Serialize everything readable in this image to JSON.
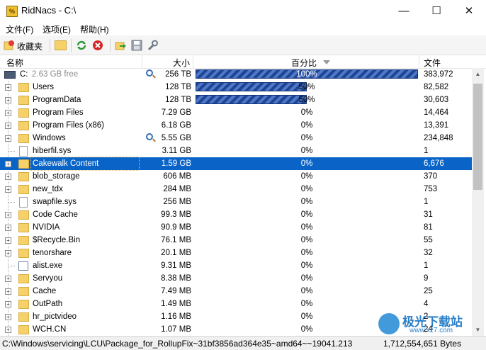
{
  "window": {
    "app_icon": "%",
    "title": "RidNacs - C:\\",
    "controls": {
      "minimize": "—",
      "maximize": "☐",
      "close": "✕"
    }
  },
  "menu": [
    "文件(F)",
    "选项(E)",
    "帮助(H)"
  ],
  "toolbar": {
    "favorites_label": "收藏夹",
    "icons": [
      "favorites-icon",
      "folder-open-icon",
      "refresh-icon",
      "stop-icon",
      "export-icon",
      "save-icon",
      "settings-icon"
    ]
  },
  "columns": {
    "name": "名称",
    "size": "大小",
    "percent": "百分比",
    "files": "文件"
  },
  "drive": {
    "label": "C:",
    "free": "2.63 GB free",
    "size": "256 TB",
    "percent": "100%",
    "percent_value": 100,
    "files": "383,972"
  },
  "rows": [
    {
      "name": "Users",
      "type": "folder",
      "size": "128 TB",
      "percent": "50%",
      "percent_value": 50,
      "files": "82,582",
      "expandable": true,
      "search": false
    },
    {
      "name": "ProgramData",
      "type": "folder",
      "size": "128 TB",
      "percent": "50%",
      "percent_value": 50,
      "files": "30,603",
      "expandable": true,
      "search": false
    },
    {
      "name": "Program Files",
      "type": "folder",
      "size": "7.29 GB",
      "percent": "0%",
      "percent_value": 0,
      "files": "14,464",
      "expandable": true,
      "search": false
    },
    {
      "name": "Program Files (x86)",
      "type": "folder",
      "size": "6.18 GB",
      "percent": "0%",
      "percent_value": 0,
      "files": "13,391",
      "expandable": true,
      "search": false
    },
    {
      "name": "Windows",
      "type": "folder",
      "size": "5.55 GB",
      "percent": "0%",
      "percent_value": 0,
      "files": "234,848",
      "expandable": true,
      "search": true
    },
    {
      "name": "hiberfil.sys",
      "type": "file",
      "size": "3.11 GB",
      "percent": "0%",
      "percent_value": 0,
      "files": "1",
      "expandable": false,
      "search": false
    },
    {
      "name": "Cakewalk Content",
      "type": "folder",
      "size": "1.59 GB",
      "percent": "0%",
      "percent_value": 0,
      "files": "6,676",
      "expandable": true,
      "search": false,
      "selected": true
    },
    {
      "name": "blob_storage",
      "type": "folder",
      "size": "606 MB",
      "percent": "0%",
      "percent_value": 0,
      "files": "370",
      "expandable": true,
      "search": false
    },
    {
      "name": "new_tdx",
      "type": "folder",
      "size": "284 MB",
      "percent": "0%",
      "percent_value": 0,
      "files": "753",
      "expandable": true,
      "search": false
    },
    {
      "name": "swapfile.sys",
      "type": "file",
      "size": "256 MB",
      "percent": "0%",
      "percent_value": 0,
      "files": "1",
      "expandable": false,
      "search": false
    },
    {
      "name": "Code Cache",
      "type": "folder",
      "size": "99.3 MB",
      "percent": "0%",
      "percent_value": 0,
      "files": "31",
      "expandable": true,
      "search": false
    },
    {
      "name": "NVIDIA",
      "type": "folder",
      "size": "90.9 MB",
      "percent": "0%",
      "percent_value": 0,
      "files": "81",
      "expandable": true,
      "search": false
    },
    {
      "name": "$Recycle.Bin",
      "type": "folder",
      "size": "76.1 MB",
      "percent": "0%",
      "percent_value": 0,
      "files": "55",
      "expandable": true,
      "search": false
    },
    {
      "name": "tenorshare",
      "type": "folder",
      "size": "20.1 MB",
      "percent": "0%",
      "percent_value": 0,
      "files": "32",
      "expandable": true,
      "search": false
    },
    {
      "name": "alist.exe",
      "type": "exe",
      "size": "9.31 MB",
      "percent": "0%",
      "percent_value": 0,
      "files": "1",
      "expandable": false,
      "search": false
    },
    {
      "name": "Servyou",
      "type": "folder",
      "size": "8.38 MB",
      "percent": "0%",
      "percent_value": 0,
      "files": "9",
      "expandable": true,
      "search": false
    },
    {
      "name": "Cache",
      "type": "folder",
      "size": "7.49 MB",
      "percent": "0%",
      "percent_value": 0,
      "files": "25",
      "expandable": true,
      "search": false
    },
    {
      "name": "OutPath",
      "type": "folder",
      "size": "1.49 MB",
      "percent": "0%",
      "percent_value": 0,
      "files": "4",
      "expandable": true,
      "search": false
    },
    {
      "name": "hr_pictvideo",
      "type": "folder",
      "size": "1.16 MB",
      "percent": "0%",
      "percent_value": 0,
      "files": "2",
      "expandable": true,
      "search": false
    },
    {
      "name": "WCH.CN",
      "type": "folder",
      "size": "1.07 MB",
      "percent": "0%",
      "percent_value": 0,
      "files": "24",
      "expandable": true,
      "search": false
    }
  ],
  "status": {
    "path": "C:\\Windows\\servicing\\LCU\\Package_for_RollupFix~31bf3856ad364e35~amd64~~19041.213",
    "bytes": "1,712,554,651 Bytes"
  },
  "watermark": {
    "text": "极光下载站",
    "url": "www.xz7.com"
  },
  "colors": {
    "selection": "#0a64c8",
    "bar": "#1d4594",
    "bar_stripe": "#4f78c8"
  }
}
